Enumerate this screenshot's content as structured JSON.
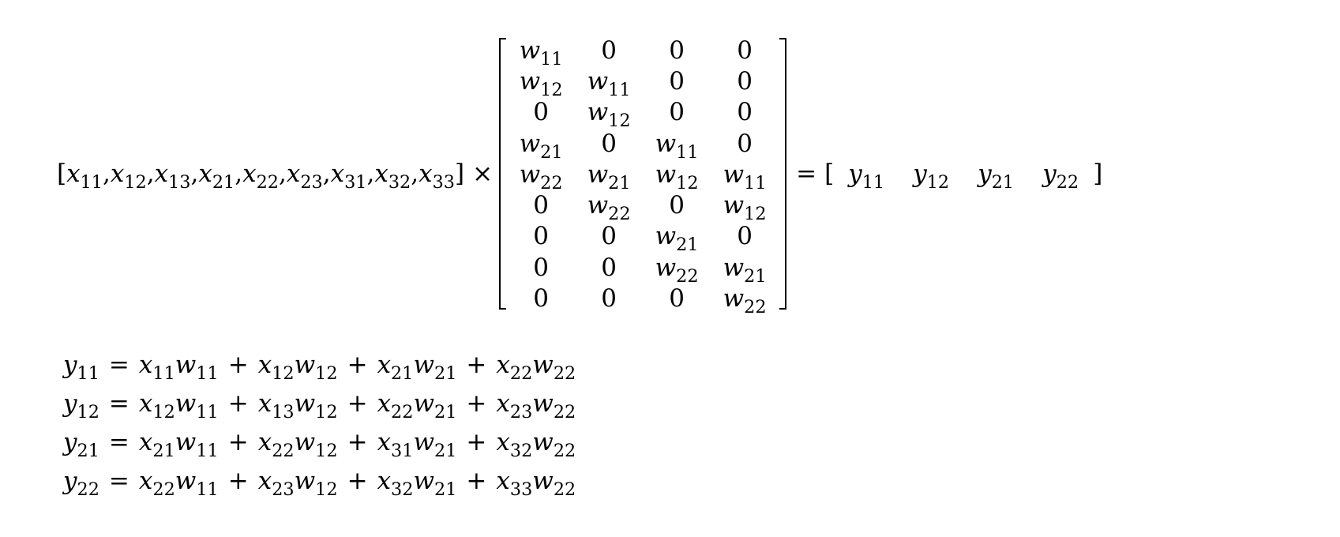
{
  "input_vector": {
    "open": "[",
    "close": "]",
    "separator": ",",
    "entries": [
      {
        "base": "x",
        "sub": "11"
      },
      {
        "base": "x",
        "sub": "12"
      },
      {
        "base": "x",
        "sub": "13"
      },
      {
        "base": "x",
        "sub": "21"
      },
      {
        "base": "x",
        "sub": "22"
      },
      {
        "base": "x",
        "sub": "23"
      },
      {
        "base": "x",
        "sub": "31"
      },
      {
        "base": "x",
        "sub": "32"
      },
      {
        "base": "x",
        "sub": "33"
      }
    ]
  },
  "operator": "×",
  "equals": "=",
  "weight_matrix": [
    [
      {
        "base": "w",
        "sub": "11"
      },
      {
        "text": "0"
      },
      {
        "text": "0"
      },
      {
        "text": "0"
      }
    ],
    [
      {
        "base": "w",
        "sub": "12"
      },
      {
        "base": "w",
        "sub": "11"
      },
      {
        "text": "0"
      },
      {
        "text": "0"
      }
    ],
    [
      {
        "text": "0"
      },
      {
        "base": "w",
        "sub": "12"
      },
      {
        "text": "0"
      },
      {
        "text": "0"
      }
    ],
    [
      {
        "base": "w",
        "sub": "21"
      },
      {
        "text": "0"
      },
      {
        "base": "w",
        "sub": "11"
      },
      {
        "text": "0"
      }
    ],
    [
      {
        "base": "w",
        "sub": "22"
      },
      {
        "base": "w",
        "sub": "21"
      },
      {
        "base": "w",
        "sub": "12"
      },
      {
        "base": "w",
        "sub": "11"
      }
    ],
    [
      {
        "text": "0"
      },
      {
        "base": "w",
        "sub": "22"
      },
      {
        "text": "0"
      },
      {
        "base": "w",
        "sub": "12"
      }
    ],
    [
      {
        "text": "0"
      },
      {
        "text": "0"
      },
      {
        "base": "w",
        "sub": "21"
      },
      {
        "text": "0"
      }
    ],
    [
      {
        "text": "0"
      },
      {
        "text": "0"
      },
      {
        "base": "w",
        "sub": "22"
      },
      {
        "base": "w",
        "sub": "21"
      }
    ],
    [
      {
        "text": "0"
      },
      {
        "text": "0"
      },
      {
        "text": "0"
      },
      {
        "base": "w",
        "sub": "22"
      }
    ]
  ],
  "output_vector": {
    "open": "[",
    "close": "]",
    "entries": [
      {
        "base": "y",
        "sub": "11"
      },
      {
        "base": "y",
        "sub": "12"
      },
      {
        "base": "y",
        "sub": "21"
      },
      {
        "base": "y",
        "sub": "22"
      }
    ]
  },
  "equations": [
    {
      "lhs": {
        "base": "y",
        "sub": "11"
      },
      "terms": [
        [
          {
            "base": "x",
            "sub": "11"
          },
          {
            "base": "w",
            "sub": "11"
          }
        ],
        [
          {
            "base": "x",
            "sub": "12"
          },
          {
            "base": "w",
            "sub": "12"
          }
        ],
        [
          {
            "base": "x",
            "sub": "21"
          },
          {
            "base": "w",
            "sub": "21"
          }
        ],
        [
          {
            "base": "x",
            "sub": "22"
          },
          {
            "base": "w",
            "sub": "22"
          }
        ]
      ]
    },
    {
      "lhs": {
        "base": "y",
        "sub": "12"
      },
      "terms": [
        [
          {
            "base": "x",
            "sub": "12"
          },
          {
            "base": "w",
            "sub": "11"
          }
        ],
        [
          {
            "base": "x",
            "sub": "13"
          },
          {
            "base": "w",
            "sub": "12"
          }
        ],
        [
          {
            "base": "x",
            "sub": "22"
          },
          {
            "base": "w",
            "sub": "21"
          }
        ],
        [
          {
            "base": "x",
            "sub": "23"
          },
          {
            "base": "w",
            "sub": "22"
          }
        ]
      ]
    },
    {
      "lhs": {
        "base": "y",
        "sub": "21"
      },
      "terms": [
        [
          {
            "base": "x",
            "sub": "21"
          },
          {
            "base": "w",
            "sub": "11"
          }
        ],
        [
          {
            "base": "x",
            "sub": "22"
          },
          {
            "base": "w",
            "sub": "12"
          }
        ],
        [
          {
            "base": "x",
            "sub": "31"
          },
          {
            "base": "w",
            "sub": "21"
          }
        ],
        [
          {
            "base": "x",
            "sub": "32"
          },
          {
            "base": "w",
            "sub": "22"
          }
        ]
      ]
    },
    {
      "lhs": {
        "base": "y",
        "sub": "22"
      },
      "terms": [
        [
          {
            "base": "x",
            "sub": "22"
          },
          {
            "base": "w",
            "sub": "11"
          }
        ],
        [
          {
            "base": "x",
            "sub": "23"
          },
          {
            "base": "w",
            "sub": "12"
          }
        ],
        [
          {
            "base": "x",
            "sub": "32"
          },
          {
            "base": "w",
            "sub": "21"
          }
        ],
        [
          {
            "base": "x",
            "sub": "33"
          },
          {
            "base": "w",
            "sub": "22"
          }
        ]
      ]
    }
  ],
  "plus": "+"
}
